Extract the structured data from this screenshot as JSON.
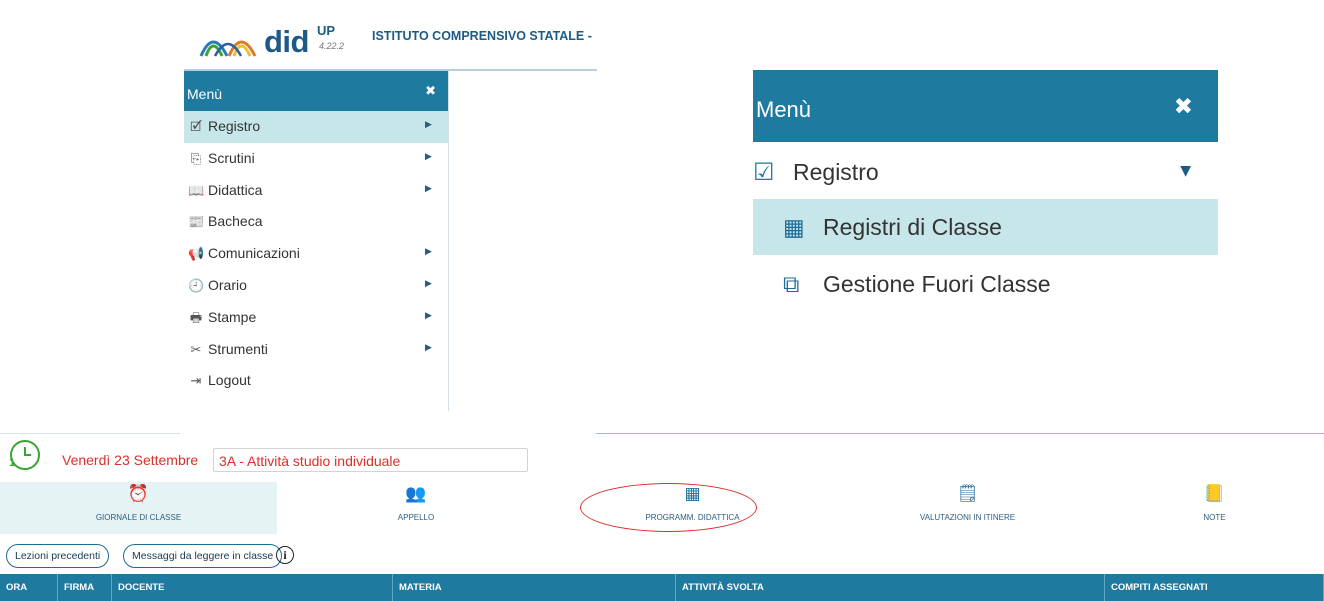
{
  "app": {
    "logo_word": "did",
    "logo_sup": "UP",
    "version": "4.22.2",
    "school_name": "ISTITUTO COMPRENSIVO STATALE -"
  },
  "sidebar": {
    "title": "Menù",
    "close_glyph": "✖",
    "items": [
      {
        "label": "Registro",
        "icon": "calendar-check-icon",
        "glyph": "🗹",
        "has_arrow": true,
        "active": true
      },
      {
        "label": "Scrutini",
        "icon": "file-export-icon",
        "glyph": "⎘",
        "has_arrow": true
      },
      {
        "label": "Didattica",
        "icon": "book-open-icon",
        "glyph": "📖",
        "has_arrow": true
      },
      {
        "label": "Bacheca",
        "icon": "newspaper-icon",
        "glyph": "📰",
        "has_arrow": false
      },
      {
        "label": "Comunicazioni",
        "icon": "megaphone-icon",
        "glyph": "📢",
        "has_arrow": true
      },
      {
        "label": "Orario",
        "icon": "clock-icon",
        "glyph": "🕘",
        "has_arrow": true
      },
      {
        "label": "Stampe",
        "icon": "printer-icon",
        "glyph": "🖶",
        "has_arrow": true
      },
      {
        "label": "Strumenti",
        "icon": "tools-icon",
        "glyph": "✂",
        "has_arrow": true
      },
      {
        "label": "Logout",
        "icon": "logout-icon",
        "glyph": "⇥",
        "has_arrow": false
      }
    ],
    "arrow_glyph": "▶"
  },
  "zoom_menu": {
    "title": "Menù",
    "close_glyph": "✖",
    "registro": {
      "label": "Registro",
      "icon": "calendar-check-icon",
      "glyph": "☑",
      "caret": "▼"
    },
    "subitems": [
      {
        "label": "Registri di Classe",
        "icon": "calendar-grid-icon",
        "glyph": "▦",
        "active": true
      },
      {
        "label": "Gestione Fuori Classe",
        "icon": "external-link-icon",
        "glyph": "⧉"
      }
    ]
  },
  "register": {
    "hour_badge": "1",
    "date": "Venerdì 23 Settembre",
    "lesson": "3A - Attività studio individuale",
    "tabs": [
      {
        "label": "GIORNALE DI CLASSE",
        "icon": "alarm-clock-icon",
        "glyph": "⏰",
        "active": true
      },
      {
        "label": "APPELLO",
        "icon": "people-icon",
        "glyph": "👥"
      },
      {
        "label": "PROGRAMM. DIDATTICA",
        "icon": "calendar-grid-icon",
        "glyph": "▦",
        "highlighted": true
      },
      {
        "label": "VALUTAZIONI IN ITINERE",
        "icon": "evaluation-icon",
        "glyph": "🗒"
      },
      {
        "label": "NOTE",
        "icon": "notes-icon",
        "glyph": "📒"
      }
    ],
    "buttons": {
      "previous_lessons": "Lezioni precedenti",
      "messages": "Messaggi da leggere in classe",
      "info": "i"
    },
    "columns": [
      "ORA",
      "FIRMA",
      "DOCENTE",
      "MATERIA",
      "ATTIVITÀ SVOLTA",
      "COMPITI ASSEGNATI"
    ]
  },
  "colors": {
    "teal": "#1e7a9e",
    "active_row": "#c6e6ea",
    "red": "#d9302a",
    "green": "#3aa335",
    "navy": "#1d5a86"
  }
}
